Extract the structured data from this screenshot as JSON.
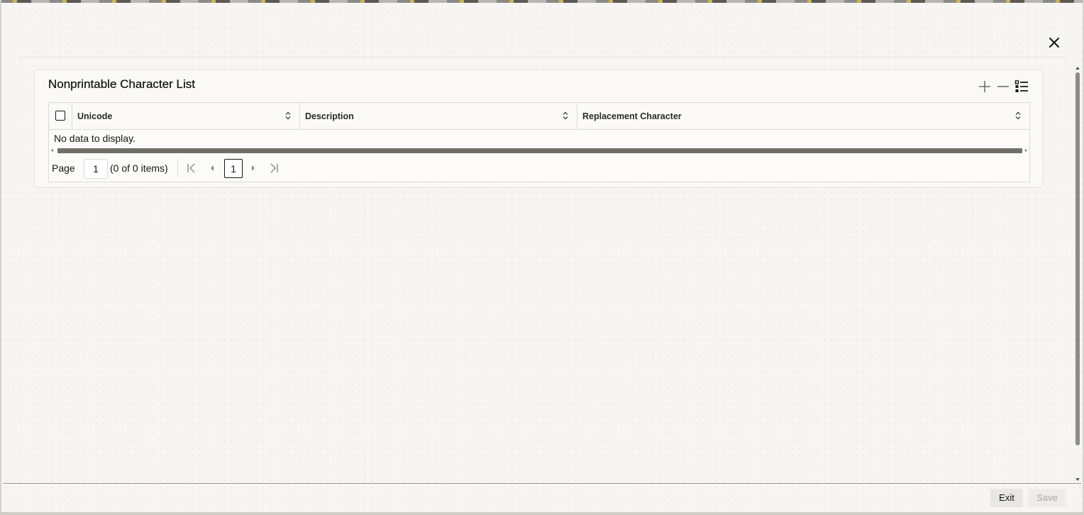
{
  "panel": {
    "title": "Nonprintable Character List"
  },
  "table": {
    "columns": [
      "Unicode",
      "Description",
      "Replacement Character"
    ],
    "empty_message": "No data to display."
  },
  "pagination": {
    "page_label": "Page",
    "page_value": "1",
    "items_text": "(0 of 0 items)",
    "current_page": "1"
  },
  "footer": {
    "exit_label": "Exit",
    "save_label": "Save"
  },
  "icons": {
    "close": "close-icon",
    "add": "plus-icon",
    "remove": "minus-icon",
    "columns": "list-view-icon",
    "sort": "sort-icon",
    "first": "first-page-icon",
    "prev": "previous-page-icon",
    "next": "next-page-icon",
    "last": "last-page-icon"
  },
  "colors": {
    "text": "#161513",
    "border": "#dcdad6",
    "scrollbar": "#6f6e6b"
  }
}
